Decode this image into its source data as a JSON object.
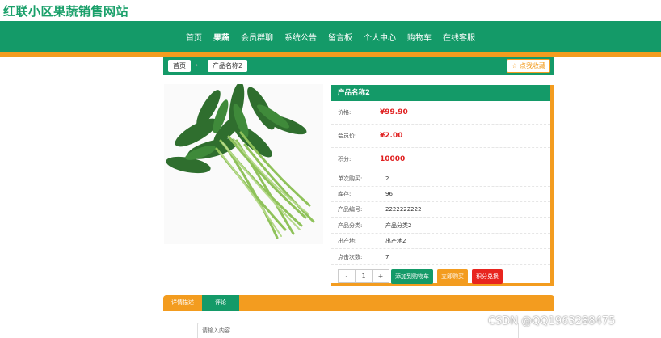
{
  "site": {
    "title": "红联小区果蔬销售网站"
  },
  "nav": {
    "items": [
      "首页",
      "果蔬",
      "会员群聊",
      "系统公告",
      "留言板",
      "个人中心",
      "购物车",
      "在线客服"
    ],
    "active_index": 1
  },
  "breadcrumb": {
    "home": "首页",
    "current": "产品名称2"
  },
  "favorite_label": "☆ 点我收藏",
  "product": {
    "name": "产品名称2",
    "fields": [
      {
        "label": "价格:",
        "value": "¥99.90",
        "price": true
      },
      {
        "label": "会员价:",
        "value": "¥2.00",
        "price": true
      },
      {
        "label": "积分:",
        "value": "10000",
        "price": true
      },
      {
        "label": "单次购买:",
        "value": "2"
      },
      {
        "label": "库存:",
        "value": "96"
      },
      {
        "label": "产品编号:",
        "value": "2222222222"
      },
      {
        "label": "产品分类:",
        "value": "产品分类2"
      },
      {
        "label": "出产地:",
        "value": "出产地2"
      },
      {
        "label": "点击次数:",
        "value": "7"
      }
    ]
  },
  "quantity": {
    "minus": "-",
    "value": "1",
    "plus": "+"
  },
  "actions": {
    "add_cart": "添加到购物车",
    "buy_now": "立即购买",
    "points_redeem": "积分兑换"
  },
  "tabs": {
    "details": "详情描述",
    "reviews": "评论"
  },
  "comment": {
    "placeholder": "请输入内容"
  },
  "watermark": "CSDN @QQ1963288475",
  "colors": {
    "green": "#149a68",
    "orange": "#f39c1f",
    "price_red": "#e02020"
  }
}
